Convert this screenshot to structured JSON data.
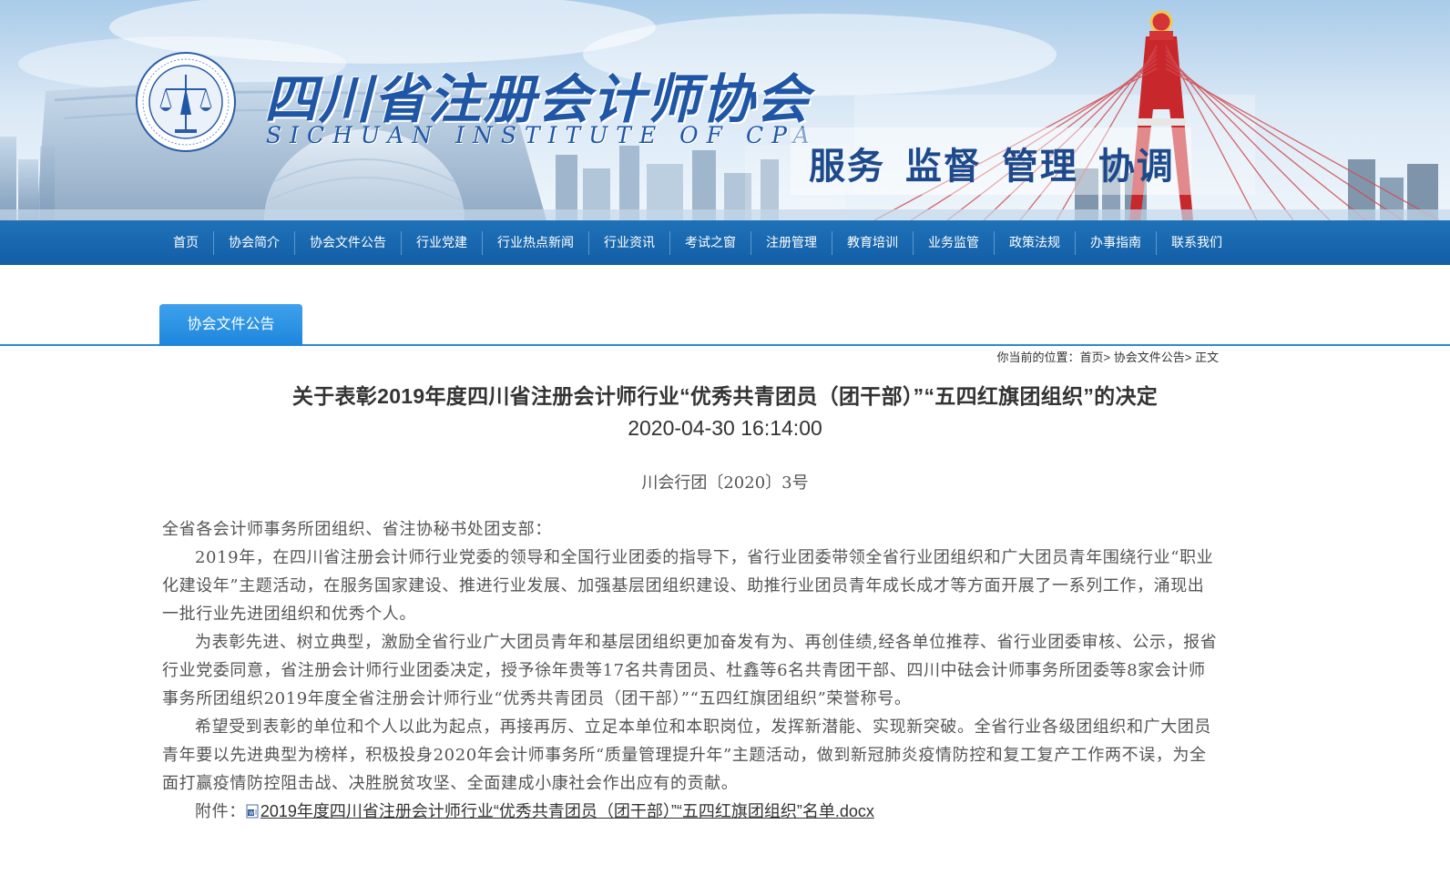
{
  "header": {
    "title": "四川省注册会计师协会",
    "subtitle": "SICHUAN INSTITUTE OF CPA",
    "emblem_text": "SICHUAN INSTITUTE OF CERTIFIED PUBLIC ACCOUNTANTS",
    "slogan": "服务 监督 管理 协调"
  },
  "nav": {
    "items": [
      {
        "label": "首页"
      },
      {
        "label": "协会简介"
      },
      {
        "label": "协会文件公告"
      },
      {
        "label": "行业党建"
      },
      {
        "label": "行业热点新闻"
      },
      {
        "label": "行业资讯"
      },
      {
        "label": "考试之窗"
      },
      {
        "label": "注册管理"
      },
      {
        "label": "教育培训"
      },
      {
        "label": "业务监管"
      },
      {
        "label": "政策法规"
      },
      {
        "label": "办事指南"
      },
      {
        "label": "联系我们"
      }
    ]
  },
  "section_tab": "协会文件公告",
  "breadcrumb": {
    "prefix": "你当前的位置：",
    "home": "首页",
    "sep1": "> ",
    "section": "协会文件公告",
    "sep2": "> ",
    "current": "正文"
  },
  "article": {
    "title": "关于表彰2019年度四川省注册会计师行业“优秀共青团员（团干部）”“五四红旗团组织”的决定",
    "date": "2020-04-30 16:14:00",
    "doc_number": "川会行团〔2020〕3号",
    "salutation": "全省各会计师事务所团组织、省注协秘书处团支部：",
    "paragraphs": [
      "2019年，在四川省注册会计师行业党委的领导和全国行业团委的指导下，省行业团委带领全省行业团组织和广大团员青年围绕行业“职业化建设年”主题活动，在服务国家建设、推进行业发展、加强基层团组织建设、助推行业团员青年成长成才等方面开展了一系列工作，涌现出一批行业先进团组织和优秀个人。",
      "为表彰先进、树立典型，激励全省行业广大团员青年和基层团组织更加奋发有为、再创佳绩,经各单位推荐、省行业团委审核、公示，报省行业党委同意，省注册会计师行业团委决定，授予徐年贵等17名共青团员、杜鑫等6名共青团干部、四川中砝会计师事务所团委等8家会计师事务所团组织2019年度全省注册会计师行业“优秀共青团员（团干部）”“五四红旗团组织”荣誉称号。",
      "希望受到表彰的单位和个人以此为起点，再接再厉、立足本单位和本职岗位，发挥新潜能、实现新突破。全省行业各级团组织和广大团员青年要以先进典型为榜样，积极投身2020年会计师事务所“质量管理提升年”主题活动，做到新冠肺炎疫情防控和复工复产工作两不误，为全面打赢疫情防控阻击战、决胜脱贫攻坚、全面建成小康社会作出应有的贡献。"
    ],
    "attachment_label": "附件：",
    "attachment_name": "2019年度四川省注册会计师行业“优秀共青团员（团干部）”“五四红旗团组织”名单.docx"
  },
  "colors": {
    "nav_bg": "#135ea6",
    "tab_bg": "#1d86dc",
    "brand_blue": "#1f57a6",
    "slogan_blue": "#1e4a8c",
    "bridge_red": "#c8282c"
  },
  "icons": {
    "attachment": "word-document-icon",
    "emblem": "institute-emblem-icon"
  }
}
